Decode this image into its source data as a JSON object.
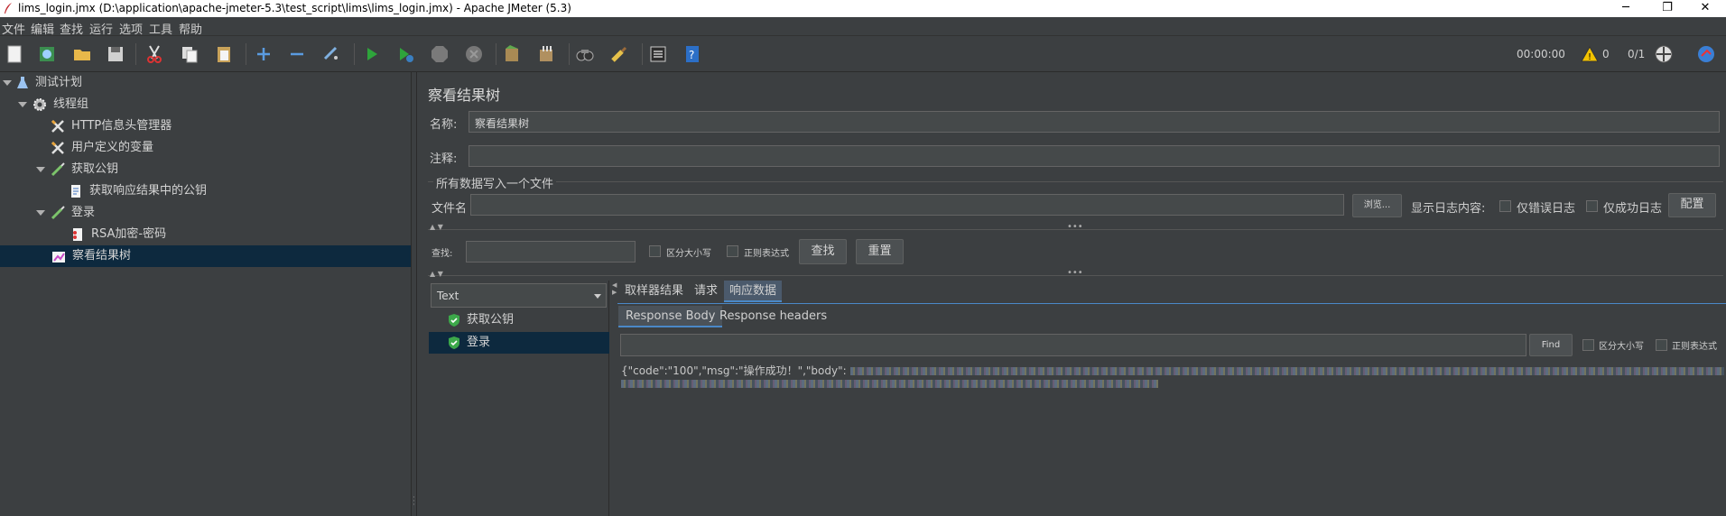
{
  "window": {
    "title": "lims_login.jmx (D:\\application\\apache-jmeter-5.3\\test_script\\lims\\lims_login.jmx) - Apache JMeter (5.3)"
  },
  "menu": [
    "文件",
    "编辑",
    "查找",
    "运行",
    "选项",
    "工具",
    "帮助"
  ],
  "toolbar": {
    "icons": [
      "new-icon",
      "templates-icon",
      "open-icon",
      "save-icon",
      "cut-icon",
      "copy-icon",
      "paste-icon",
      "expand-icon",
      "collapse-icon",
      "toggle-icon",
      "start-icon",
      "start-no-timers-icon",
      "stop-icon",
      "shutdown-icon",
      "clear-icon",
      "clear-all-icon",
      "search-icon",
      "reset-search-icon",
      "function-helper-icon",
      "help-icon"
    ],
    "timer": "00:00:00",
    "warnings": "0",
    "threads": "0/1"
  },
  "tree": [
    {
      "label": "测试计划",
      "icon": "test-plan-icon"
    },
    {
      "label": "线程组",
      "icon": "thread-group-icon"
    },
    {
      "label": "HTTP信息头管理器",
      "icon": "config-tools-icon"
    },
    {
      "label": "用户定义的变量",
      "icon": "config-tools-icon"
    },
    {
      "label": "获取公钥",
      "icon": "sampler-icon"
    },
    {
      "label": "获取响应结果中的公钥",
      "icon": "extractor-icon"
    },
    {
      "label": "登录",
      "icon": "sampler-icon"
    },
    {
      "label": "RSA加密-密码",
      "icon": "preprocessor-icon"
    },
    {
      "label": "察看结果树",
      "icon": "listener-icon"
    }
  ],
  "panel": {
    "title": "察看结果树",
    "name_label": "名称:",
    "name_value": "察看结果树",
    "comment_label": "注释:",
    "comment_value": "",
    "file_group": "所有数据写入一个文件",
    "filename_label": "文件名",
    "filename_value": "",
    "browse_button": "浏览...",
    "log_label": "显示日志内容:",
    "errors_only": "仅错误日志",
    "success_only": "仅成功日志",
    "configure_button": "配置",
    "search_label": "查找:",
    "search_value": "",
    "case_sensitive": "区分大小写",
    "regex": "正则表达式",
    "find_button": "查找",
    "reset_button": "重置"
  },
  "results": {
    "renderer": "Text",
    "samples": [
      "获取公钥",
      "登录"
    ],
    "tabs": [
      "取样器结果",
      "请求",
      "响应数据"
    ],
    "subtabs": [
      "Response Body",
      "Response headers"
    ],
    "find_value": "",
    "find_button": "Find",
    "case_sensitive": "区分大小写",
    "regex": "正则表达式",
    "response_visible": "{\"code\":\"100\",\"msg\":\"操作成功！\",\"body\":"
  },
  "colors": {
    "background": "#3c3f41",
    "selection": "#0d293e",
    "accent": "#4a88c7",
    "success": "#3ca84a"
  }
}
